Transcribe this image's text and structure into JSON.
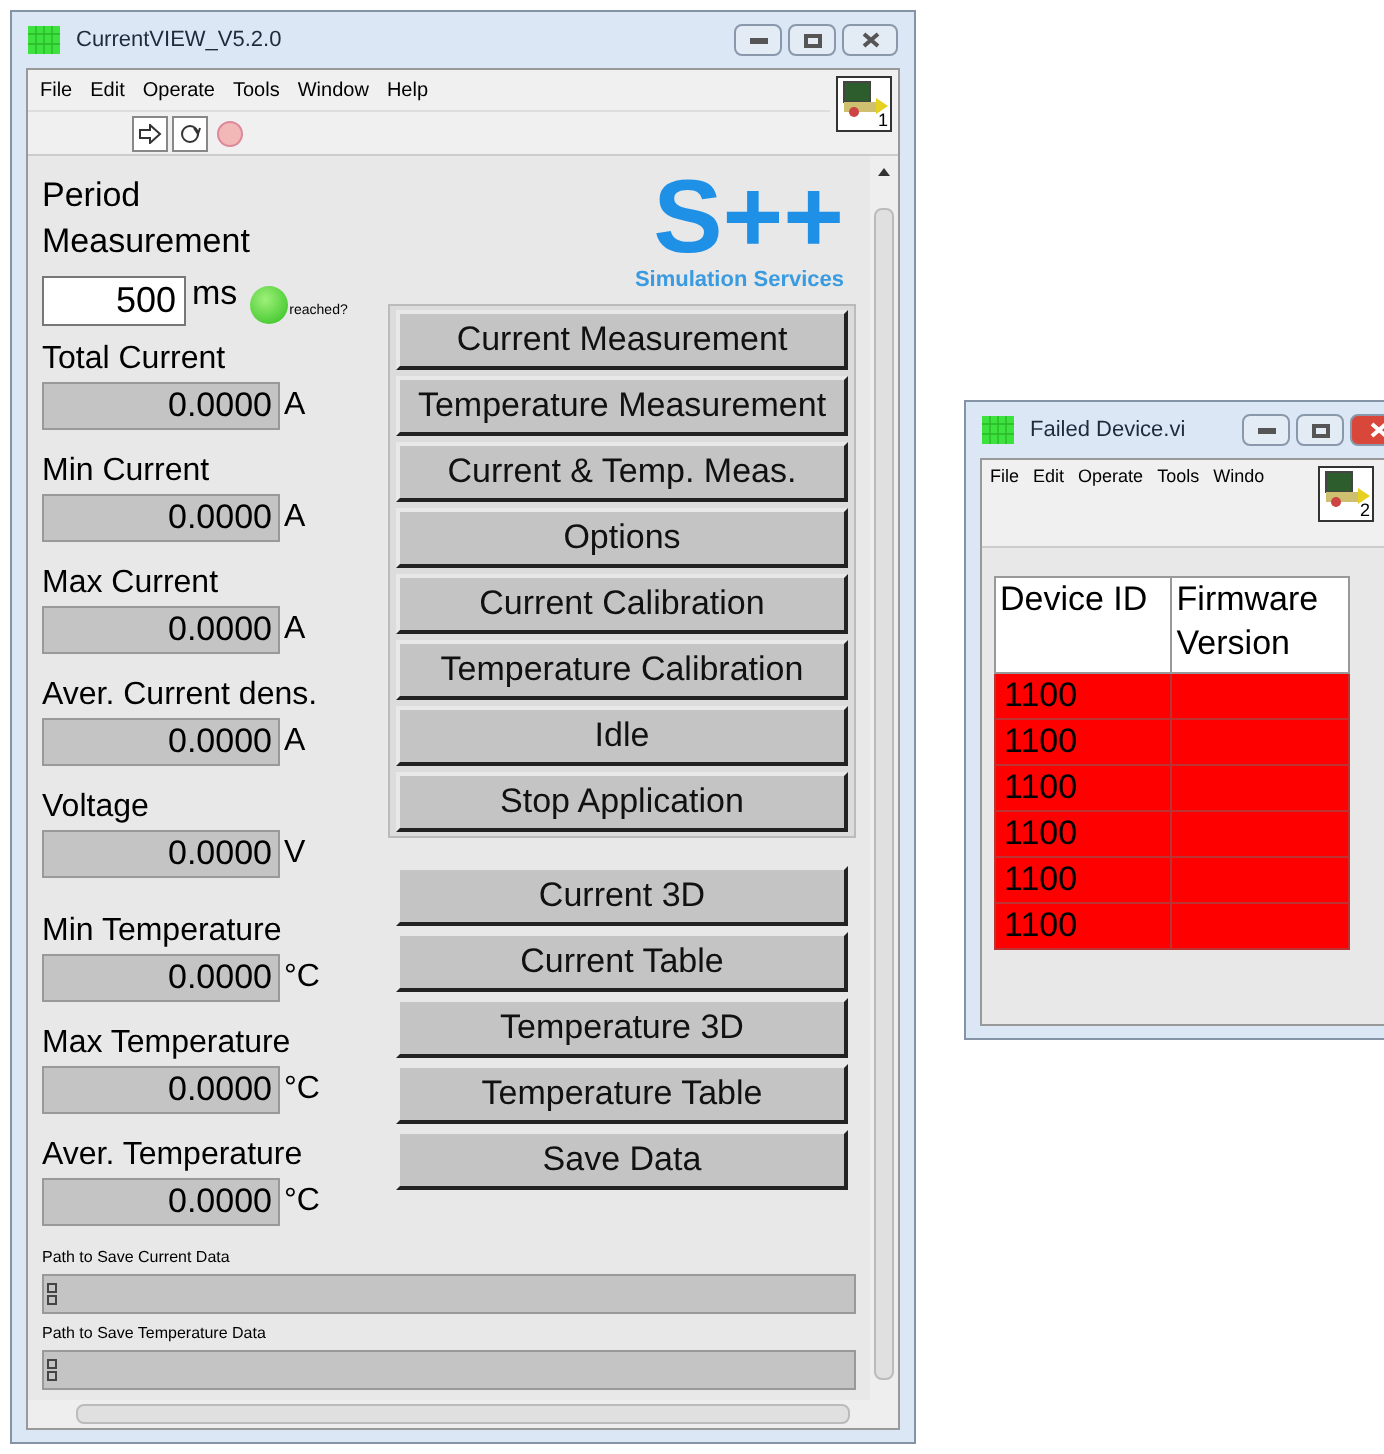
{
  "main_window": {
    "title": "CurrentVIEW_V5.2.0",
    "menu": [
      "File",
      "Edit",
      "Operate",
      "Tools",
      "Window",
      "Help"
    ],
    "vi_icon_number": "1",
    "period": {
      "label": "Period Measurement",
      "value": "500",
      "unit": "ms",
      "indicator_label": "reached?",
      "on": true
    },
    "logo": {
      "mark": "S++",
      "subtitle": "Simulation Services"
    },
    "readouts": [
      {
        "label": "Total Current",
        "value": "0.0000",
        "unit": "A"
      },
      {
        "label": "Min Current",
        "value": "0.0000",
        "unit": "A"
      },
      {
        "label": "Max Current",
        "value": "0.0000",
        "unit": "A"
      },
      {
        "label": "Aver. Current dens.",
        "value": "0.0000",
        "unit": "A"
      },
      {
        "label": "Voltage",
        "value": "0.0000",
        "unit": "V"
      },
      {
        "label": "Min Temperature",
        "value": "0.0000",
        "unit": "°C"
      },
      {
        "label": "Max Temperature",
        "value": "0.0000",
        "unit": "°C"
      },
      {
        "label": "Aver. Temperature",
        "value": "0.0000",
        "unit": "°C"
      }
    ],
    "mode_buttons": [
      "Current Measurement",
      "Temperature Measurement",
      "Current & Temp. Meas.",
      "Options",
      "Current Calibration",
      "Temperature Calibration",
      "Idle",
      "Stop Application"
    ],
    "view_buttons": [
      "Current 3D",
      "Current Table",
      "Temperature 3D",
      "Temperature Table",
      "Save Data"
    ],
    "paths": [
      {
        "label": "Path to Save Current Data"
      },
      {
        "label": "Path to Save Temperature Data"
      }
    ]
  },
  "failed_window": {
    "title": "Failed Device.vi",
    "menu": [
      "File",
      "Edit",
      "Operate",
      "Tools",
      "Windo"
    ],
    "vi_icon_number": "2",
    "table": {
      "columns": [
        "Device ID",
        "Firmware Version"
      ],
      "rows": [
        {
          "device_id": "1100",
          "color": "#ff0000"
        },
        {
          "device_id": "1100",
          "color": "#ff0000"
        },
        {
          "device_id": "1100",
          "color": "#ff0000"
        },
        {
          "device_id": "1100",
          "color": "#ff0000"
        },
        {
          "device_id": "1100",
          "color": "#ff0000"
        },
        {
          "device_id": "1100",
          "color": "#ff0000"
        }
      ]
    }
  }
}
